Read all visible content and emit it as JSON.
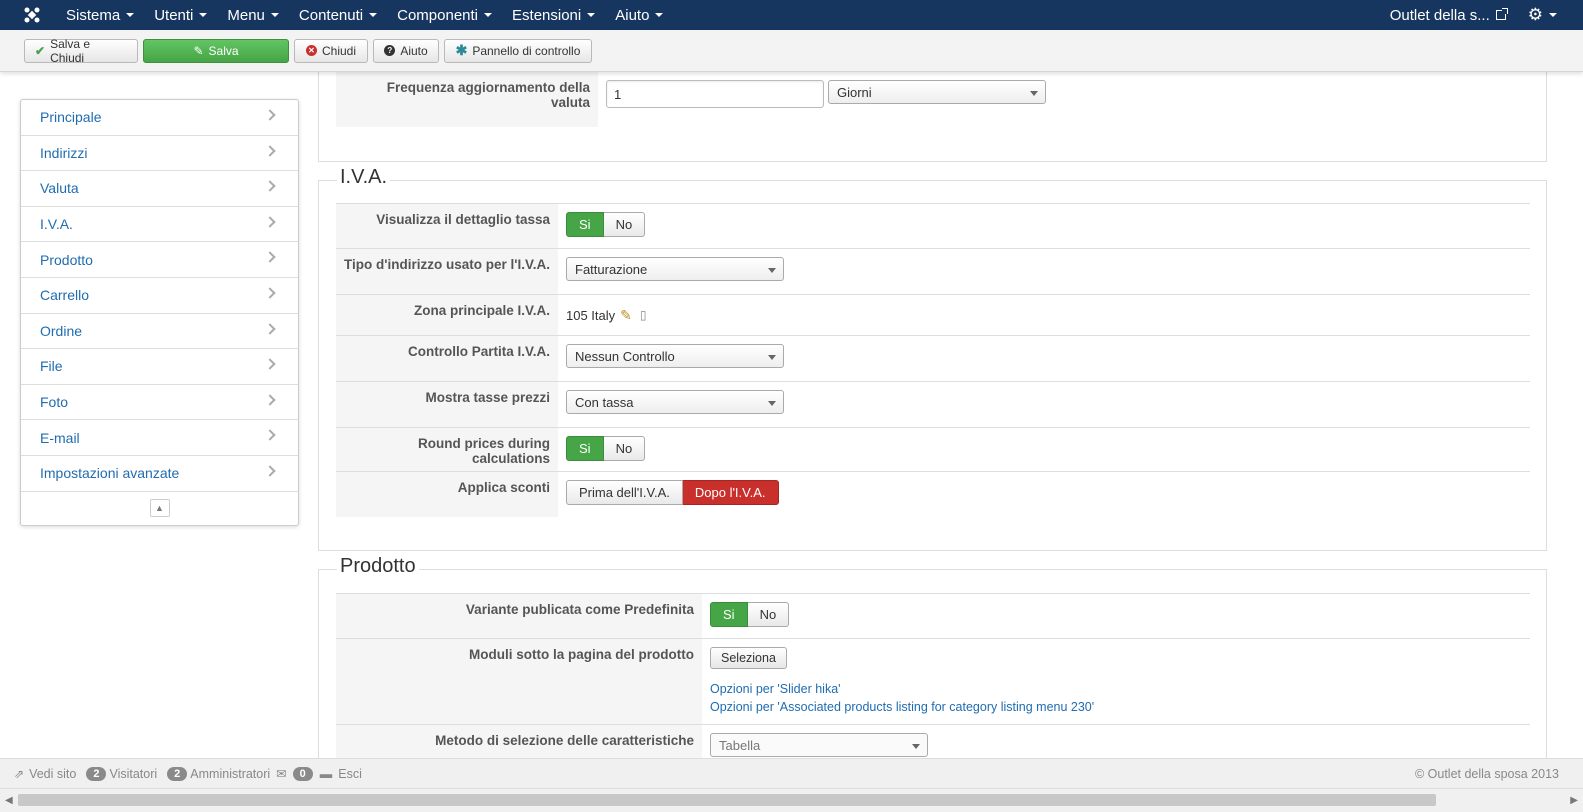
{
  "navbar": {
    "menus": [
      "Sistema",
      "Utenti",
      "Menu",
      "Contenuti",
      "Componenti",
      "Estensioni",
      "Aiuto"
    ],
    "site_name": "Outlet della s...",
    "logo_icon": "joomla-logo-icon",
    "settings_icon": "gear-icon"
  },
  "toolbar": {
    "save_close": "Salva e Chiudi",
    "save": "Salva",
    "close": "Chiudi",
    "help": "Aiuto",
    "control_panel": "Pannello di controllo"
  },
  "sidebar": {
    "items": [
      "Principale",
      "Indirizzi",
      "Valuta",
      "I.V.A.",
      "Prodotto",
      "Carrello",
      "Ordine",
      "File",
      "Foto",
      "E-mail",
      "Impostazioni avanzate"
    ]
  },
  "currency": {
    "freq_label": "Frequenza aggiornamento della valuta",
    "freq_value": "1",
    "freq_unit": "Giorni"
  },
  "iva": {
    "legend": "I.V.A.",
    "show_tax_label": "Visualizza il dettaglio tassa",
    "yes": "Si",
    "no": "No",
    "address_type_label": "Tipo d'indirizzo usato per l'I.V.A.",
    "address_type_value": "Fatturazione",
    "main_zone_label": "Zona principale I.V.A.",
    "main_zone_value": "105 Italy",
    "vat_check_label": "Controllo Partita I.V.A.",
    "vat_check_value": "Nessun Controllo",
    "price_tax_label": "Mostra tasse prezzi",
    "price_tax_value": "Con tassa",
    "round_label": "Round prices during calculations",
    "discount_label": "Applica sconti",
    "discount_before": "Prima dell'I.V.A.",
    "discount_after": "Dopo l'I.V.A."
  },
  "product": {
    "legend": "Prodotto",
    "variant_label": "Variante publicata come Predefinita",
    "modules_label": "Moduli sotto la pagina del prodotto",
    "select_button": "Seleziona",
    "link1": "Opzioni per 'Slider hika'",
    "link2": "Opzioni per 'Associated products listing for category listing menu 230'",
    "feature_method_label": "Metodo di selezione delle caratteristiche",
    "feature_method_value": "Tabella"
  },
  "footer": {
    "view_site": "Vedi sito",
    "visitors_count": "2",
    "visitors_label": "Visitatori",
    "admins_count": "2",
    "admins_label": "Amministratori",
    "messages_count": "0",
    "logout": "Esci",
    "copyright": "© Outlet della sposa 2013"
  }
}
